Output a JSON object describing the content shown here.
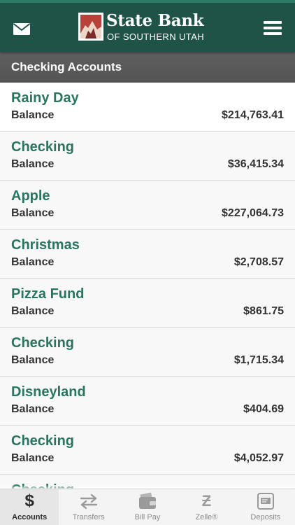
{
  "header": {
    "bank_name": "State Bank",
    "bank_subtitle": "OF SOUTHERN UTAH",
    "mail_icon": "envelope-icon",
    "menu_icon": "hamburger-menu-icon"
  },
  "section": {
    "title": "Checking Accounts"
  },
  "accounts": [
    {
      "name": "Rainy Day",
      "balance_label": "Balance",
      "balance": "$214,763.41"
    },
    {
      "name": "Checking",
      "balance_label": "Balance",
      "balance": "$36,415.34"
    },
    {
      "name": "Apple",
      "balance_label": "Balance",
      "balance": "$227,064.73"
    },
    {
      "name": "Christmas",
      "balance_label": "Balance",
      "balance": "$2,708.57"
    },
    {
      "name": "Pizza Fund",
      "balance_label": "Balance",
      "balance": "$861.75"
    },
    {
      "name": "Checking",
      "balance_label": "Balance",
      "balance": "$1,715.34"
    },
    {
      "name": "Disneyland",
      "balance_label": "Balance",
      "balance": "$404.69"
    },
    {
      "name": "Checking",
      "balance_label": "Balance",
      "balance": "$4,052.97"
    },
    {
      "name": "Checking",
      "balance_label": "",
      "balance": ""
    }
  ],
  "tabs": [
    {
      "label": "Accounts",
      "icon": "dollar-icon",
      "active": true
    },
    {
      "label": "Transfers",
      "icon": "transfer-arrows-icon",
      "active": false
    },
    {
      "label": "Bill Pay",
      "icon": "wallet-icon",
      "active": false
    },
    {
      "label": "Zelle®",
      "icon": "zelle-icon",
      "active": false
    },
    {
      "label": "Deposits",
      "icon": "check-deposit-icon",
      "active": false
    }
  ],
  "colors": {
    "header_bg": "#1f5347",
    "account_name": "#2a7561",
    "section_bar": "#5a5a5a"
  }
}
